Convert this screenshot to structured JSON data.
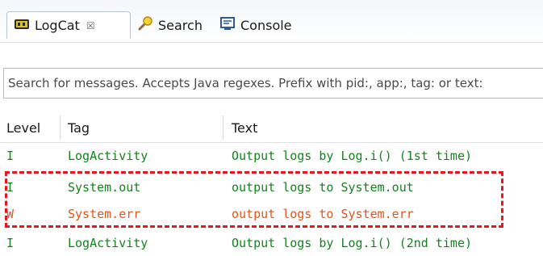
{
  "tabs": [
    {
      "label": "LogCat",
      "icon": "logcat-icon",
      "close": "☒",
      "active": true
    },
    {
      "label": "Search",
      "icon": "search-icon",
      "active": false
    },
    {
      "label": "Console",
      "icon": "console-icon",
      "active": false
    }
  ],
  "search": {
    "placeholder": "Search for messages. Accepts Java regexes. Prefix with pid:, app:, tag: or text:"
  },
  "columns": {
    "level": "Level",
    "tag": "Tag",
    "text": "Text"
  },
  "rows": [
    {
      "level": "I",
      "tag": "LogActivity",
      "text": "Output logs by Log.i() (1st time)"
    },
    {
      "level": "I",
      "tag": "System.out",
      "text": "output logs to System.out"
    },
    {
      "level": "W",
      "tag": "System.err",
      "text": "output logs to System.err"
    },
    {
      "level": "I",
      "tag": "LogActivity",
      "text": "Output logs by Log.i() (2nd time)"
    }
  ],
  "colors": {
    "info": "#14831e",
    "warn": "#e0561a",
    "highlight": "#e8161e"
  }
}
